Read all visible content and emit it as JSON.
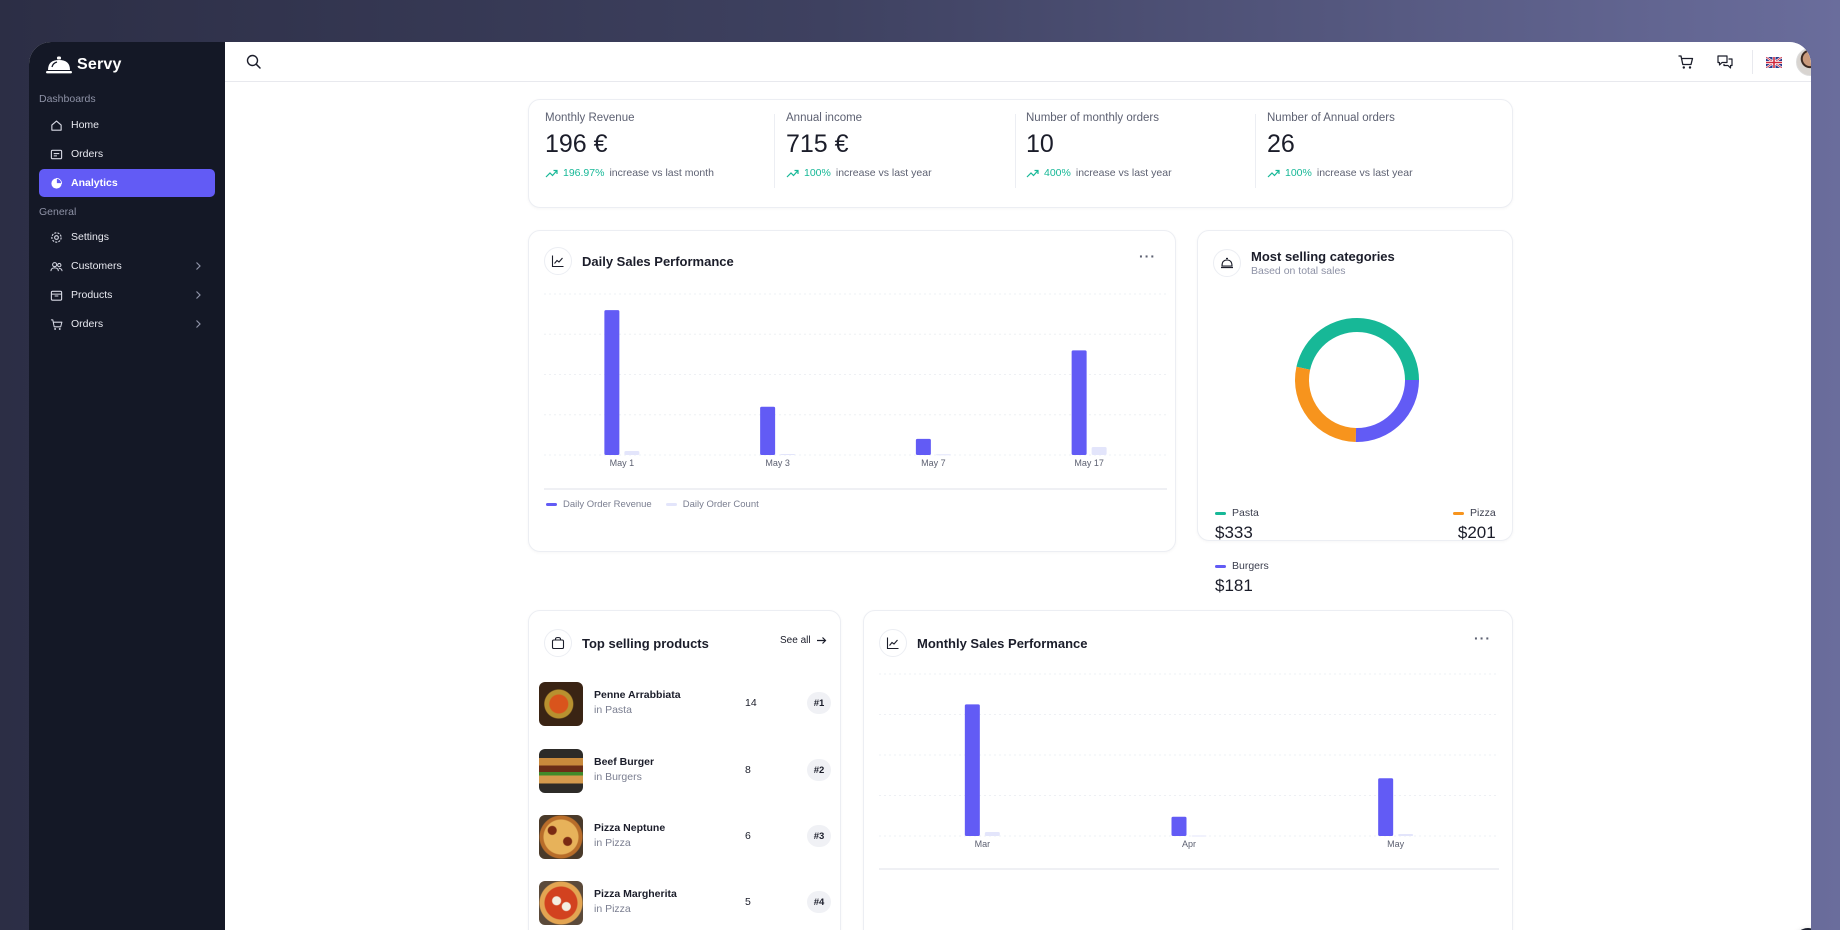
{
  "brand": {
    "name": "Servy"
  },
  "sidebar": {
    "sections": [
      {
        "label": "Dashboards"
      },
      {
        "label": "General"
      }
    ],
    "items": [
      {
        "label": "Home",
        "icon": "home-icon"
      },
      {
        "label": "Orders",
        "icon": "orders-icon"
      },
      {
        "label": "Analytics",
        "icon": "pie-chart-icon",
        "active": true
      },
      {
        "label": "Settings",
        "icon": "gear-icon"
      },
      {
        "label": "Customers",
        "icon": "users-icon"
      },
      {
        "label": "Products",
        "icon": "box-icon"
      },
      {
        "label": "Orders",
        "icon": "cart-icon"
      }
    ]
  },
  "topbar": {
    "icons": [
      "search-icon",
      "cart-icon",
      "chat-icon",
      "uk-flag-icon",
      "avatar"
    ]
  },
  "stats": [
    {
      "title": "Monthly Revenue",
      "value": "196 €",
      "pct": "196.97%",
      "rest": "increase vs last month"
    },
    {
      "title": "Annual income",
      "value": "715 €",
      "pct": "100%",
      "rest": "increase vs last year"
    },
    {
      "title": "Number of monthly orders",
      "value": "10",
      "pct": "400%",
      "rest": "increase vs last year"
    },
    {
      "title": "Number of Annual orders",
      "value": "26",
      "pct": "100%",
      "rest": "increase vs last year"
    }
  ],
  "daily": {
    "title": "Daily Sales Performance"
  },
  "categories": {
    "title": "Most selling categories",
    "subtitle": "Based on total sales",
    "items": [
      {
        "name": "Pasta",
        "value": "$333"
      },
      {
        "name": "Pizza",
        "value": "$201"
      },
      {
        "name": "Burgers",
        "value": "$181"
      }
    ]
  },
  "top_products": {
    "title": "Top selling products",
    "see_all": "See all",
    "items": [
      {
        "name": "Penne Arrabbiata",
        "category": "in Pasta",
        "qty": "14",
        "rank": "#1"
      },
      {
        "name": "Beef Burger",
        "category": "in Burgers",
        "qty": "8",
        "rank": "#2"
      },
      {
        "name": "Pizza Neptune",
        "category": "in Pizza",
        "qty": "6",
        "rank": "#3"
      },
      {
        "name": "Pizza Margherita",
        "category": "in Pizza",
        "qty": "5",
        "rank": "#4"
      }
    ]
  },
  "monthly": {
    "title": "Monthly Sales Performance"
  },
  "colors": {
    "accent": "#625bf5",
    "light": "#e3e5fb",
    "teal": "#17b897",
    "orange": "#f7941d",
    "sidebar": "#141826"
  },
  "chart_data": [
    {
      "type": "bar",
      "categories": [
        "May 1",
        "May 3",
        "May 7",
        "May 17"
      ],
      "series": [
        {
          "name": "Daily Order Revenue",
          "values": [
            72,
            24,
            8,
            52
          ],
          "color": "#625bf5"
        },
        {
          "name": "Daily Order Count",
          "values": [
            2,
            0.5,
            0.4,
            4
          ],
          "color": "#e3e5fb"
        }
      ],
      "ylim": [
        0,
        80
      ],
      "grid": true,
      "legend": "bottom-left"
    },
    {
      "type": "pie",
      "categories": [
        "Pasta",
        "Pizza",
        "Burgers"
      ],
      "values": [
        333,
        201,
        181
      ],
      "colors": [
        "#17b897",
        "#f7941d",
        "#625bf5"
      ],
      "legend": "bottom"
    },
    {
      "type": "bar",
      "categories": [
        "Mar",
        "Apr",
        "May"
      ],
      "series": [
        {
          "values": [
            130,
            19,
            57
          ],
          "color": "#625bf5"
        },
        {
          "values": [
            4,
            0.5,
            2
          ],
          "color": "#e3e5fb"
        }
      ],
      "ylim": [
        0,
        160
      ],
      "grid": true
    }
  ]
}
